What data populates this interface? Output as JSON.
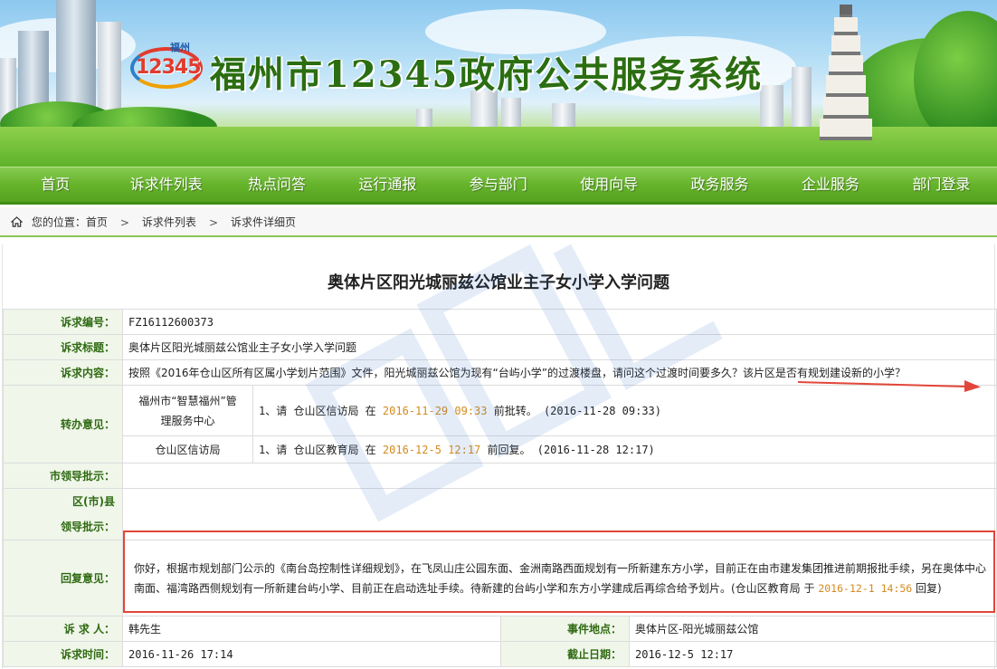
{
  "header": {
    "logo_city": "福州",
    "logo_number": "12345",
    "system_title": "福州市12345政府公共服务系统"
  },
  "nav": {
    "items": [
      "首页",
      "诉求件列表",
      "热点问答",
      "运行通报",
      "参与部门",
      "使用向导",
      "政务服务",
      "企业服务",
      "部门登录"
    ]
  },
  "breadcrumb": {
    "prefix": "您的位置：",
    "items": [
      "首页",
      "诉求件列表",
      "诉求件详细页"
    ]
  },
  "detail": {
    "title": "奥体片区阳光城丽兹公馆业主子女小学入学问题",
    "id_label": "诉求编号：",
    "id_value": "FZ16112600373",
    "subject_label": "诉求标题：",
    "subject_value": "奥体片区阳光城丽兹公馆业主子女小学入学问题",
    "content_label": "诉求内容：",
    "content_value": "按照《2016年仓山区所有区属小学划片范围》文件，阳光城丽兹公馆为现有“台屿小学”的过渡楼盘，请问这个过渡时间要多久？该片区是否有规划建设新的小学？",
    "transfer_label": "转办意见：",
    "transfers": [
      {
        "dept_line1": "福州市“智慧福州”管",
        "dept_line2": "理服务中心",
        "prefix": "1、请  仓山区信访局  在 ",
        "deadline": "2016-11-29 09:33",
        "suffix": "  前批转。 (2016-11-28 09:33)"
      },
      {
        "dept_line1": "仓山区信访局",
        "dept_line2": "",
        "prefix": "1、请  仓山区教育局  在 ",
        "deadline": "2016-12-5 12:17",
        "suffix": "  前回复。 (2016-11-28 12:17)"
      }
    ],
    "city_leader_label": "市领导批示：",
    "district_leader_label_1": "区(市)县",
    "district_leader_label_2": "领导批示：",
    "reply_label": "回复意见：",
    "reply_text": "你好，根据市规划部门公示的《南台岛控制性详细规划》，在飞凤山庄公园东面、金洲南路西面规划有一所新建东方小学，目前正在由市建发集团推进前期报批手续，另在奥体中心南面、福湾路西侧规划有一所新建台屿小学、目前正在启动选址手续。待新建的台屿小学和东方小学建成后再综合给予划片。(仓山区教育局 于 ",
    "reply_date": "2016-12-1 14:56",
    "reply_suffix": " 回复)",
    "requester_label": "诉 求 人：",
    "requester_value": "韩先生",
    "location_label": "事件地点：",
    "location_value": "奥体片区-阳光城丽兹公馆",
    "time_label": "诉求时间：",
    "time_value": "2016-11-26 17:14",
    "deadline_label": "截止日期：",
    "deadline_value": "2016-12-5 12:17"
  },
  "colors": {
    "nav_green": "#66b32b",
    "label_green": "#2f6a12",
    "date_orange": "#d58b1e",
    "annotation_red": "#e2463a"
  }
}
